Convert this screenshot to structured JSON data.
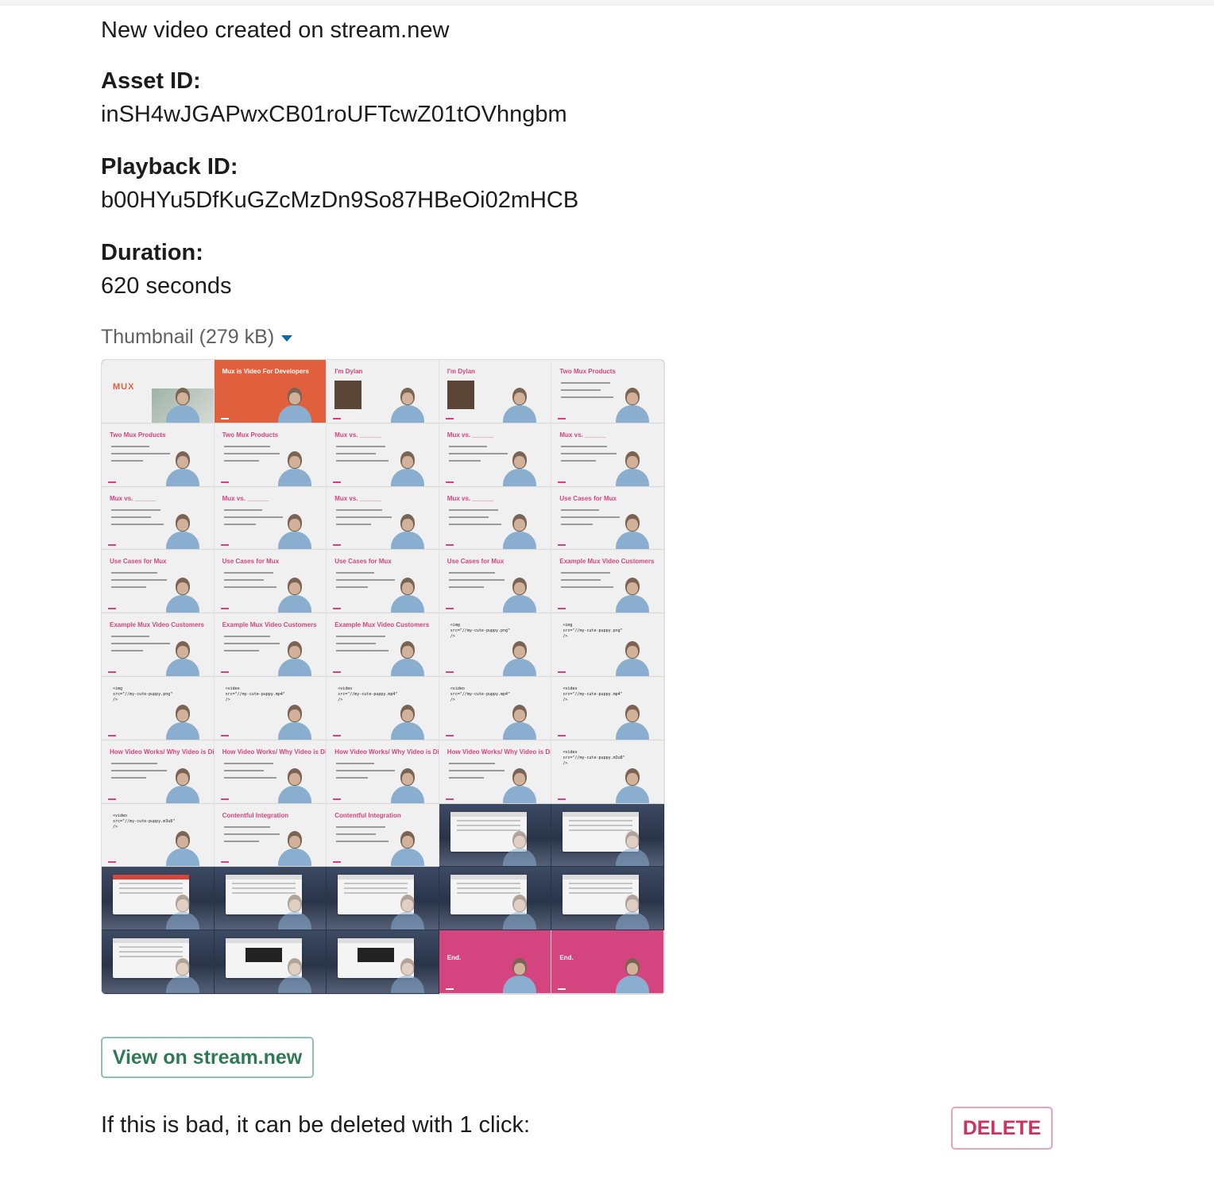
{
  "message": {
    "intro": "New video created on stream.new",
    "fields": [
      {
        "label": "Asset ID:",
        "value": "inSH4wJGAPwxCB01roUFTcwZ01tOVhngbm"
      },
      {
        "label": "Playback ID:",
        "value": "b00HYu5DfKuGZcMzDn9So87HBeOi02mHCB"
      },
      {
        "label": "Duration:",
        "value": "620 seconds"
      }
    ],
    "thumbnail": {
      "label": "Thumbnail (279 kB)",
      "toggle_icon": "caret-down-icon",
      "grid": {
        "columns": 5,
        "rows": 10,
        "frames": [
          {
            "kind": "logo",
            "title": "MUX"
          },
          {
            "kind": "orange",
            "title": "Mux is Video For Developers"
          },
          {
            "kind": "portrait",
            "title": "I'm Dylan"
          },
          {
            "kind": "portrait",
            "title": "I'm Dylan"
          },
          {
            "kind": "bullets",
            "title": "Two Mux Products"
          },
          {
            "kind": "bullets",
            "title": "Two Mux Products"
          },
          {
            "kind": "bullets",
            "title": "Two Mux Products"
          },
          {
            "kind": "bullets",
            "title": "Mux vs. ______"
          },
          {
            "kind": "bullets",
            "title": "Mux vs. ______"
          },
          {
            "kind": "bullets",
            "title": "Mux vs. ______"
          },
          {
            "kind": "bullets",
            "title": "Mux vs. ______"
          },
          {
            "kind": "bullets",
            "title": "Mux vs. ______"
          },
          {
            "kind": "bullets",
            "title": "Mux vs. ______"
          },
          {
            "kind": "bullets",
            "title": "Mux vs. ______"
          },
          {
            "kind": "bullets",
            "title": "Use Cases for Mux"
          },
          {
            "kind": "bullets",
            "title": "Use Cases for Mux"
          },
          {
            "kind": "bullets",
            "title": "Use Cases for Mux"
          },
          {
            "kind": "bullets",
            "title": "Use Cases for Mux"
          },
          {
            "kind": "bullets",
            "title": "Use Cases for Mux"
          },
          {
            "kind": "bullets",
            "title": "Example Mux Video Customers"
          },
          {
            "kind": "bullets",
            "title": "Example Mux Video Customers"
          },
          {
            "kind": "bullets",
            "title": "Example Mux Video Customers"
          },
          {
            "kind": "bullets",
            "title": "Example Mux Video Customers"
          },
          {
            "kind": "code",
            "title": "<img\nsrc=\"//my-cute-puppy.png\"\n/>"
          },
          {
            "kind": "code",
            "title": "<img\nsrc=\"//my-cute-puppy.png\"\n/>"
          },
          {
            "kind": "code",
            "title": "<img\nsrc=\"//my-cute-puppy.png\"\n/>"
          },
          {
            "kind": "code",
            "title": "<video\nsrc=\"//my-cute-puppy.mp4\"\n/>"
          },
          {
            "kind": "code",
            "title": "<video\nsrc=\"//my-cute-puppy.mp4\"\n/>"
          },
          {
            "kind": "code",
            "title": "<video\nsrc=\"//my-cute-puppy.mp4\"\n/>"
          },
          {
            "kind": "code",
            "title": "<video\nsrc=\"//my-cute-puppy.mp4\"\n/>"
          },
          {
            "kind": "bullets",
            "title": "How Video Works/ Why Video is Difficult"
          },
          {
            "kind": "bullets",
            "title": "How Video Works/ Why Video is Difficult"
          },
          {
            "kind": "bullets",
            "title": "How Video Works/ Why Video is Difficult"
          },
          {
            "kind": "bullets",
            "title": "How Video Works/ Why Video is Difficult"
          },
          {
            "kind": "code",
            "title": "<video\nsrc=\"//my-cute-puppy.m3u8\"\n/>"
          },
          {
            "kind": "code",
            "title": "<video\nsrc=\"//my-cute-puppy.m3u8\"\n/>"
          },
          {
            "kind": "bullets",
            "title": "Contentful Integration"
          },
          {
            "kind": "bullets",
            "title": "Contentful Integration"
          },
          {
            "kind": "screen",
            "title": ""
          },
          {
            "kind": "screen",
            "title": ""
          },
          {
            "kind": "screen-red",
            "title": ""
          },
          {
            "kind": "screen",
            "title": ""
          },
          {
            "kind": "screen",
            "title": ""
          },
          {
            "kind": "screen",
            "title": ""
          },
          {
            "kind": "screen",
            "title": ""
          },
          {
            "kind": "screen",
            "title": ""
          },
          {
            "kind": "screen-dark",
            "title": ""
          },
          {
            "kind": "screen-dark",
            "title": ""
          },
          {
            "kind": "pink",
            "title": "End."
          },
          {
            "kind": "pink",
            "title": "End."
          }
        ]
      }
    },
    "view_button_label": "View on stream.new",
    "delete_prompt": "If this is bad, it can be deleted with 1 click:",
    "delete_button_label": "DELETE"
  },
  "colors": {
    "brand_pink": "#d4457f",
    "brand_orange": "#e0603d",
    "view_button_text": "#2e7a55",
    "delete_button_text": "#d0315f",
    "caret": "#1264a3"
  }
}
